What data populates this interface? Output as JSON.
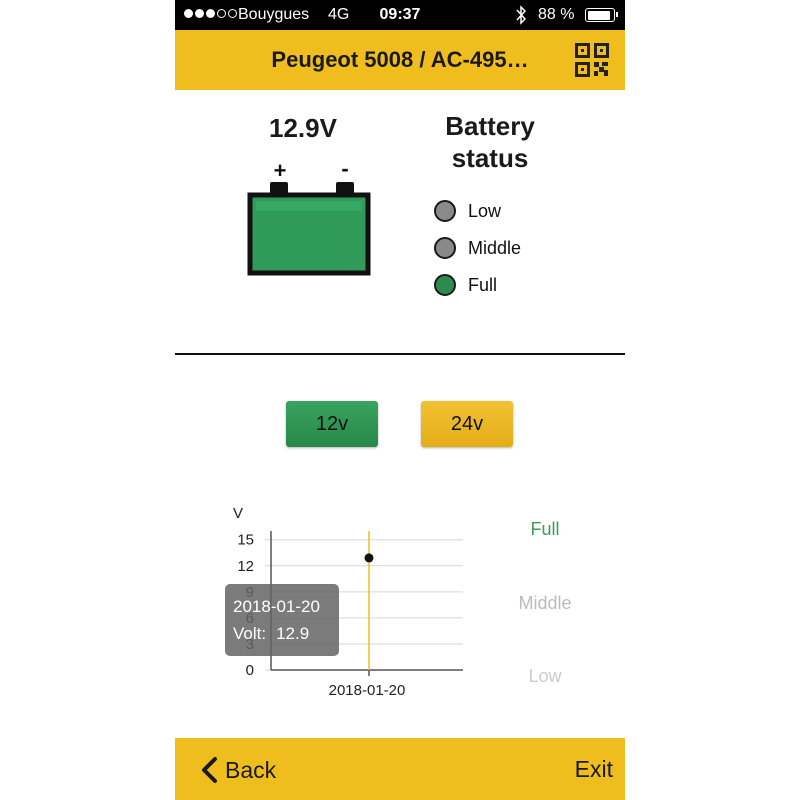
{
  "status_bar": {
    "carrier": "Bouygues",
    "network": "4G",
    "time": "09:37",
    "battery_percent": "88 %",
    "signal_bars_filled": 3,
    "signal_bars_total": 5
  },
  "header": {
    "title": "Peugeot 5008 / AC-495…",
    "qr_icon": "qr-code-icon"
  },
  "battery": {
    "voltage": "12.9V",
    "plus": "+",
    "minus": "-",
    "status_title": "Battery status",
    "levels": [
      {
        "label": "Low",
        "color": "#8a8a8a",
        "active": false
      },
      {
        "label": "Middle",
        "color": "#8a8a8a",
        "active": false
      },
      {
        "label": "Full",
        "color": "#2e8b4f",
        "active": true
      }
    ]
  },
  "voltage_buttons": {
    "v12": "12v",
    "v24": "24v"
  },
  "chart_data": {
    "type": "scatter",
    "ylabel": "V",
    "xlabel": "",
    "title": "",
    "y_ticks": [
      "0",
      "3",
      "6",
      "9",
      "12",
      "15"
    ],
    "ylim": [
      0,
      16
    ],
    "categories": [
      "2018-01-20"
    ],
    "series": [
      {
        "values": [
          12.9
        ]
      }
    ],
    "levels": [
      "Full",
      "Middle",
      "Low"
    ],
    "tooltip": {
      "date": "2018-01-20",
      "label": "Volt:",
      "value": "12.9"
    }
  },
  "footer": {
    "back": "Back",
    "exit": "Exit"
  },
  "colors": {
    "accent": "#f0bd1f",
    "full_green": "#2e8b4f",
    "gray": "#8a8a8a"
  }
}
